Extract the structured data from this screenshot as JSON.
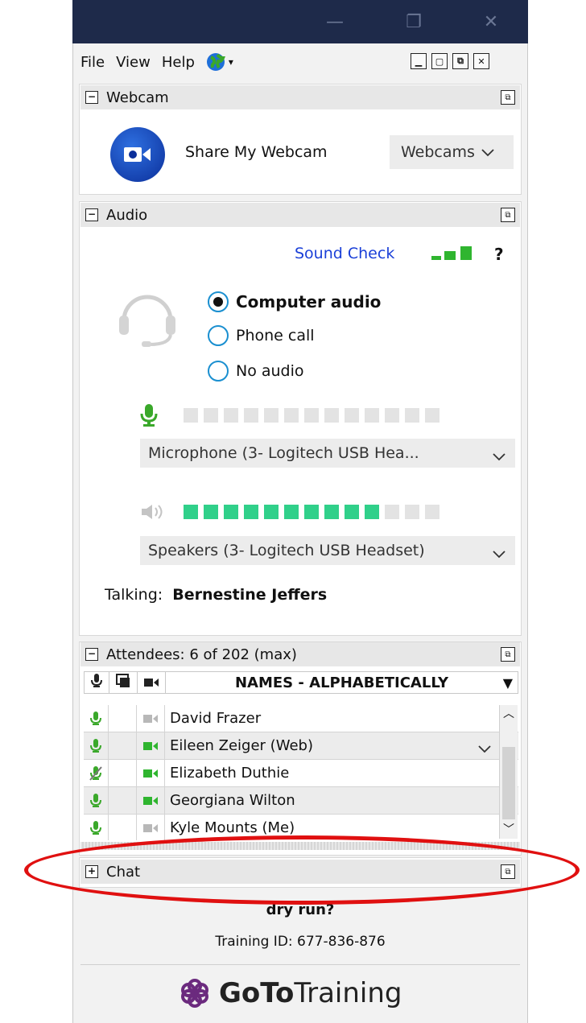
{
  "titlebar": {
    "minimize": "—",
    "restore": "❐",
    "close": "✕"
  },
  "menu": {
    "items": [
      "File",
      "View",
      "Help"
    ]
  },
  "webcam": {
    "title": "Webcam",
    "share_label": "Share My Webcam",
    "select": "Webcams"
  },
  "audio": {
    "title": "Audio",
    "sound_check": "Sound Check",
    "help": "?",
    "options": [
      {
        "label": "Computer audio",
        "selected": true
      },
      {
        "label": "Phone call",
        "selected": false
      },
      {
        "label": "No audio",
        "selected": false
      }
    ],
    "microphone": "Microphone (3- Logitech USB Hea...",
    "mic_level_active": 0,
    "speakers": "Speakers (3- Logitech USB Headset)",
    "speaker_level_active": 10,
    "level_total": 13,
    "talking_label": "Talking:",
    "talking_name": "Bernestine Jeffers"
  },
  "attendees": {
    "title": "Attendees:  6 of 202 (max)",
    "column_names": "NAMES - ALPHABETICALLY",
    "rows": [
      {
        "name": "David Frazer",
        "mic": "on",
        "cam": "off"
      },
      {
        "name": "Eileen Zeiger (Web)",
        "mic": "on",
        "cam": "on"
      },
      {
        "name": "Elizabeth Duthie",
        "mic": "muted",
        "cam": "on"
      },
      {
        "name": "Georgiana Wilton",
        "mic": "on",
        "cam": "on"
      },
      {
        "name": "Kyle Mounts (Me)",
        "mic": "on",
        "cam": "off"
      }
    ]
  },
  "chat": {
    "title": "Chat"
  },
  "footer": {
    "session": "dry run?",
    "training_id": "Training ID: 677-836-876",
    "brand_goto": "GoTo",
    "brand_training": "Training"
  },
  "colors": {
    "accent_green": "#30d08a",
    "link_blue": "#1a3fd8",
    "annotation_red": "#e01010",
    "titlebar": "#1e2a4a"
  }
}
